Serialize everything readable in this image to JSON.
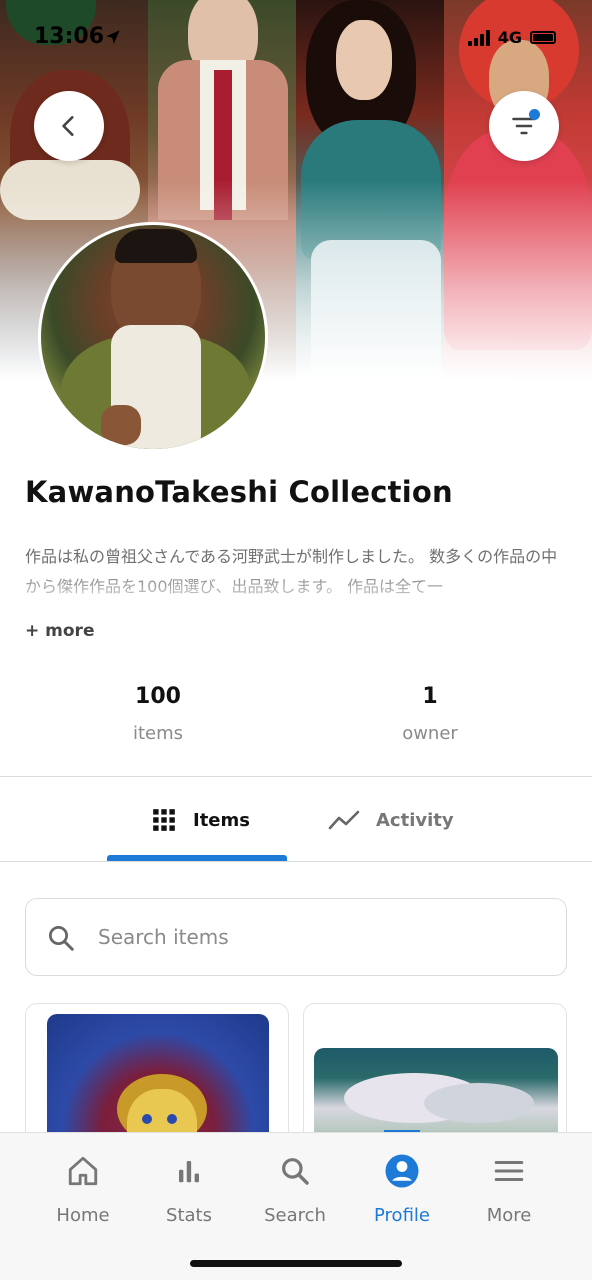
{
  "status_bar": {
    "time": "13:06",
    "network": "4G",
    "icons": [
      "location-arrow-icon",
      "signal-icon",
      "battery-icon"
    ]
  },
  "header": {
    "back_icon": "chevron-left-icon",
    "filter_icon": "filter-icon",
    "filter_badge_color": "#1d7ad6"
  },
  "profile": {
    "title": "KawanoTakeshi  Collection",
    "description": "作品は私の曾祖父さんである河野武士が制作しました。 数多くの作品の中から傑作作品を100個選び、出品致します。 作品は全て一",
    "more_label": "+ more"
  },
  "stats": {
    "items_value": "100",
    "items_label": "items",
    "owner_value": "1",
    "owner_label": "owner"
  },
  "tabs": {
    "items_label": "Items",
    "activity_label": "Activity",
    "active": "Items"
  },
  "search": {
    "placeholder": "Search items"
  },
  "bottom_nav": {
    "home": "Home",
    "stats": "Stats",
    "search": "Search",
    "profile": "Profile",
    "more": "More",
    "active": "Profile"
  },
  "colors": {
    "accent": "#1d7ad6",
    "text_primary": "#111111",
    "text_muted": "#8a8a8a"
  }
}
